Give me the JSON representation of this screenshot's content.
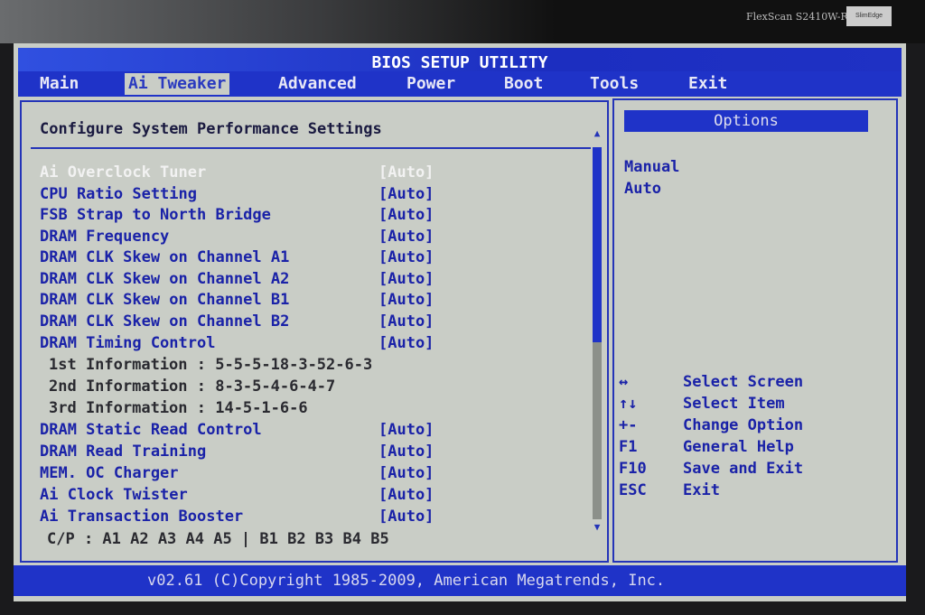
{
  "monitor": {
    "model": "FlexScan S2410W-R",
    "badge": "SlimEdge"
  },
  "title": "BIOS SETUP UTILITY",
  "tabs": [
    "Main",
    "Ai Tweaker",
    "Advanced",
    "Power",
    "Boot",
    "Tools",
    "Exit"
  ],
  "active_tab": "Ai Tweaker",
  "heading": "Configure System Performance Settings",
  "settings": [
    {
      "label": "Ai Overclock Tuner",
      "value": "[Auto]"
    },
    {
      "label": "CPU Ratio Setting",
      "value": "[Auto]"
    },
    {
      "label": "FSB Strap to North Bridge",
      "value": "[Auto]"
    },
    {
      "label": "DRAM Frequency",
      "value": "[Auto]"
    },
    {
      "label": "DRAM CLK Skew on Channel A1",
      "value": "[Auto]"
    },
    {
      "label": "DRAM CLK Skew on Channel A2",
      "value": "[Auto]"
    },
    {
      "label": "DRAM CLK Skew on Channel B1",
      "value": "[Auto]"
    },
    {
      "label": "DRAM CLK Skew on Channel B2",
      "value": "[Auto]"
    },
    {
      "label": "DRAM Timing Control",
      "value": "[Auto]"
    }
  ],
  "info": [
    "1st Information : 5-5-5-18-3-52-6-3",
    "2nd Information : 8-3-5-4-6-4-7",
    "3rd Information : 14-5-1-6-6"
  ],
  "settings2": [
    {
      "label": "DRAM Static Read Control",
      "value": "[Auto]"
    },
    {
      "label": "DRAM Read Training",
      "value": "[Auto]"
    },
    {
      "label": "MEM. OC Charger",
      "value": "[Auto]"
    },
    {
      "label": "Ai Clock Twister",
      "value": "[Auto]"
    },
    {
      "label": "Ai Transaction Booster",
      "value": "[Auto]"
    }
  ],
  "cp_line": "C/P : A1 A2 A3 A4 A5 | B1 B2 B3 B4 B5",
  "options": {
    "title": "Options",
    "items": [
      "Manual",
      "Auto"
    ]
  },
  "keys": [
    {
      "key": "↔",
      "desc": "Select Screen"
    },
    {
      "key": "↑↓",
      "desc": "Select Item"
    },
    {
      "key": "+-",
      "desc": "Change Option"
    },
    {
      "key": "F1",
      "desc": "General Help"
    },
    {
      "key": "F10",
      "desc": "Save and Exit"
    },
    {
      "key": "ESC",
      "desc": "Exit"
    }
  ],
  "footer": "v02.61 (C)Copyright 1985-2009, American Megatrends, Inc."
}
